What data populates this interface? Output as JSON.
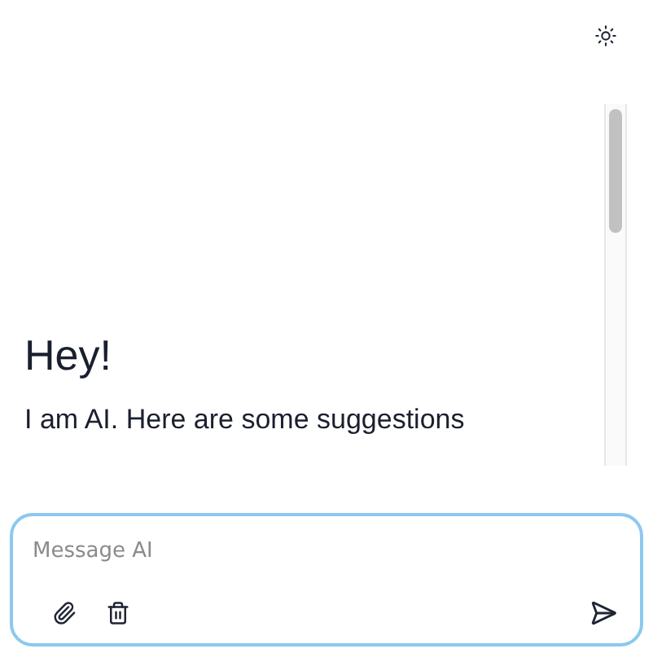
{
  "greeting": {
    "title": "Hey!",
    "subtitle": "I am AI. Here are some suggestions"
  },
  "composer": {
    "placeholder": "Message AI"
  }
}
